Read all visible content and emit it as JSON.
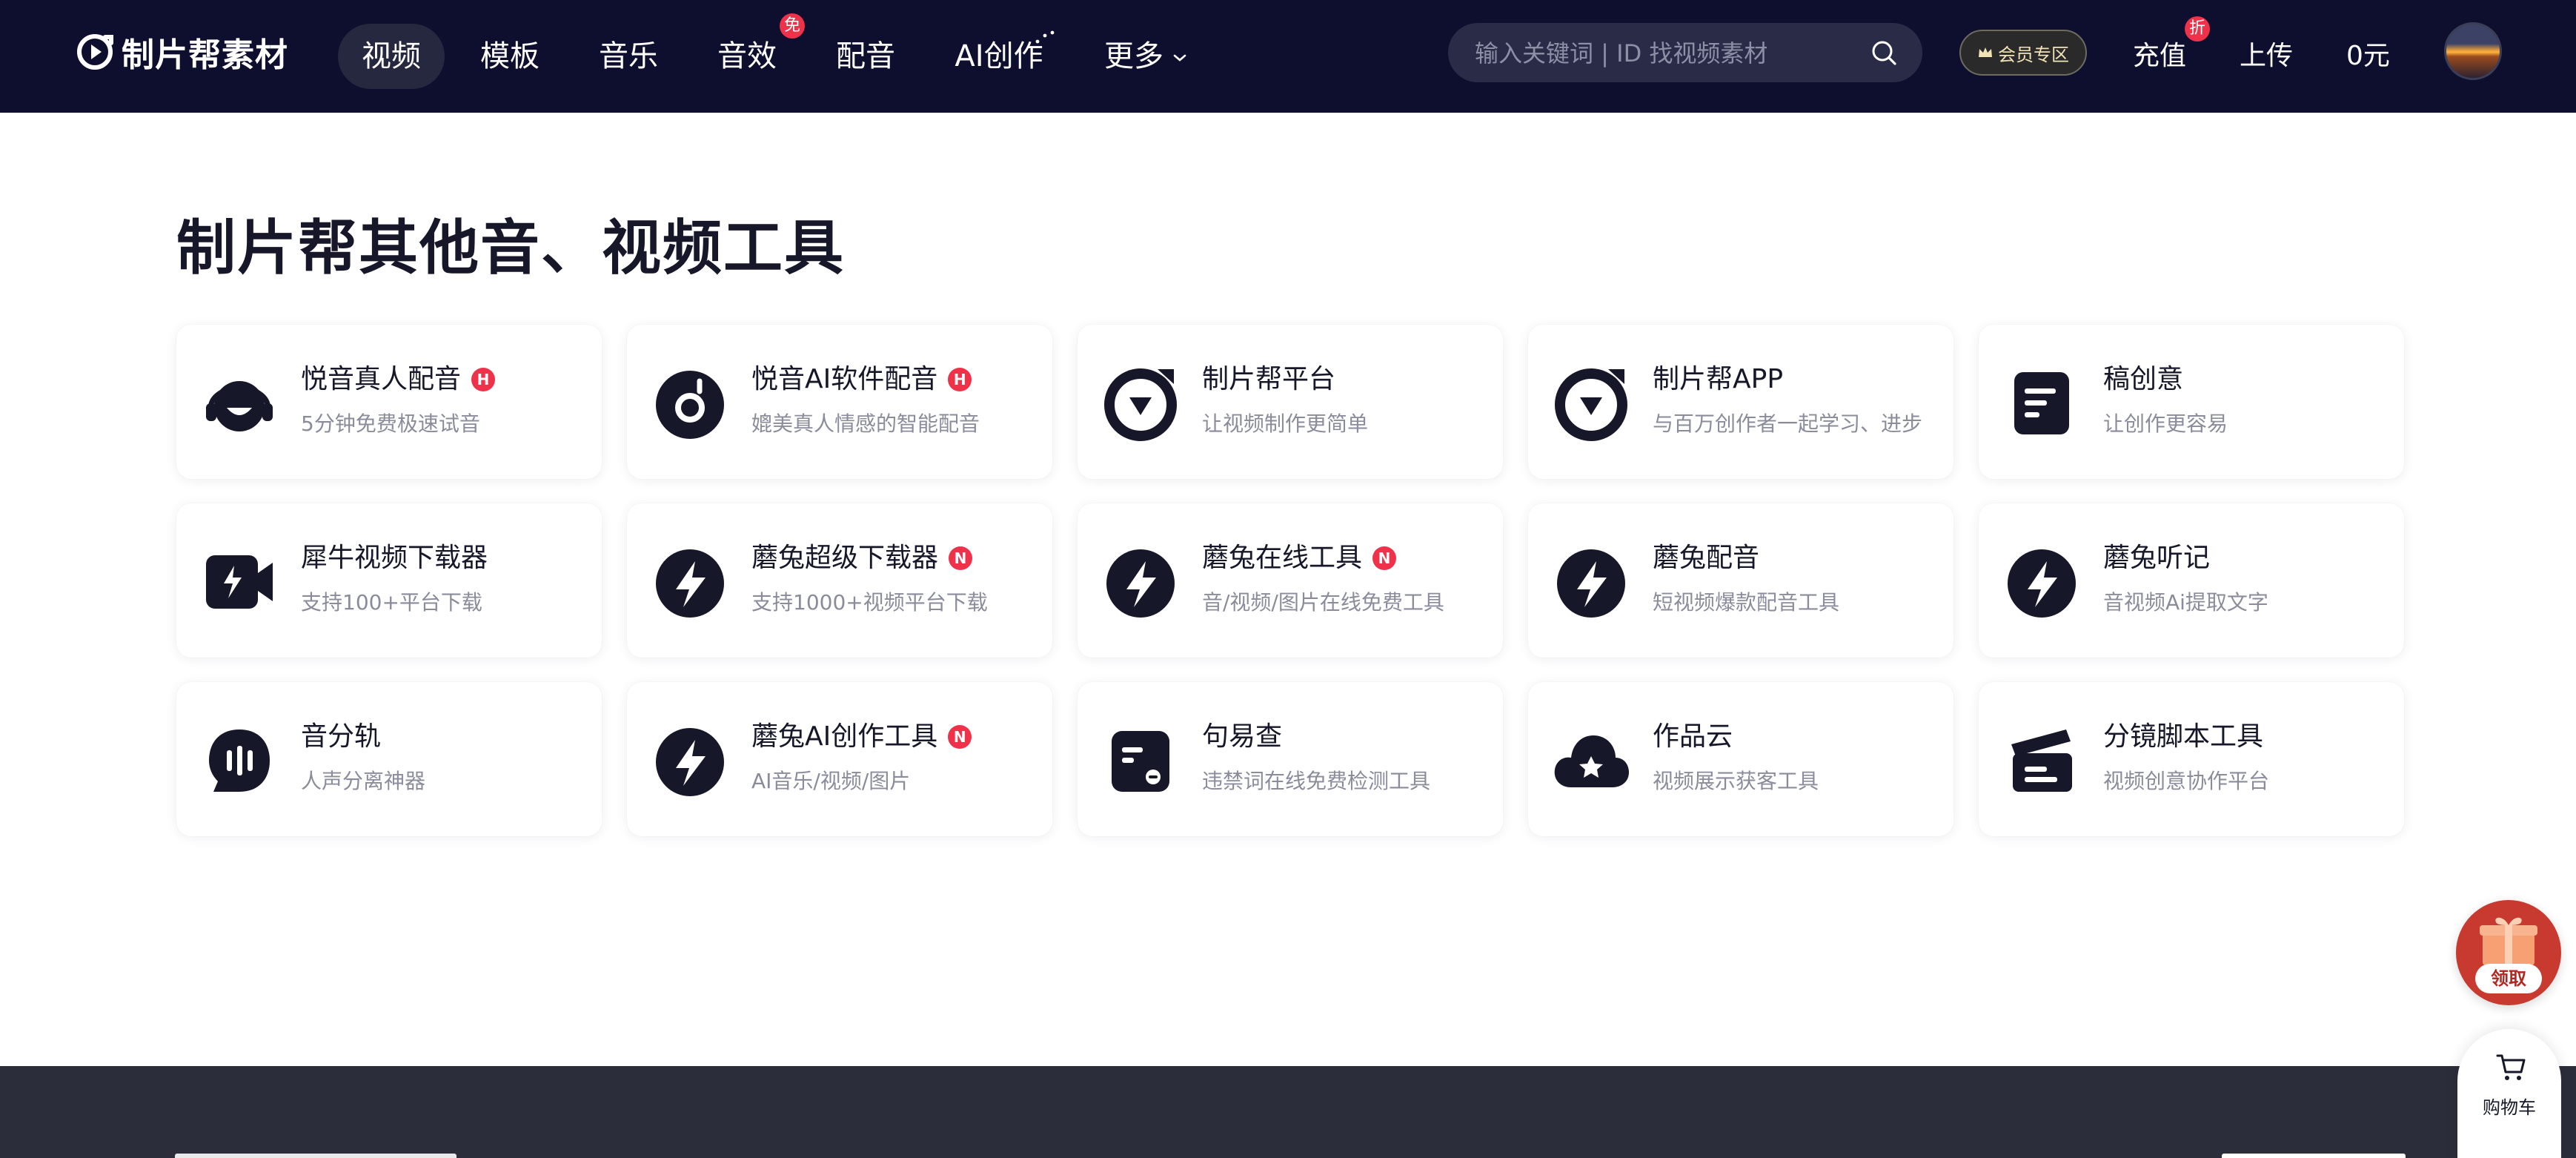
{
  "nav": {
    "logo_text": "制片帮素材",
    "items": [
      {
        "label": "视频",
        "active": true
      },
      {
        "label": "模板"
      },
      {
        "label": "音乐"
      },
      {
        "label": "音效",
        "badge": "免"
      },
      {
        "label": "配音"
      },
      {
        "label": "AI创作"
      },
      {
        "label": "更多"
      }
    ],
    "search_placeholder": "输入关键词 | ID 找视频素材",
    "vip_label": "会员专区",
    "recharge_label": "充值",
    "recharge_badge": "折",
    "upload_label": "上传",
    "balance_label": "0元"
  },
  "main": {
    "title": "制片帮其他音、视频工具",
    "tools": [
      {
        "title": "悦音真人配音",
        "badge": "H",
        "desc": "5分钟免费极速试音",
        "icon": "headset-icon"
      },
      {
        "title": "悦音AI软件配音",
        "badge": "H",
        "desc": "媲美真人情感的智能配音",
        "icon": "music-disc-icon"
      },
      {
        "title": "制片帮平台",
        "desc": "让视频制作更简单",
        "icon": "zhipianbang-logo-icon"
      },
      {
        "title": "制片帮APP",
        "desc": "与百万创作者一起学习、进步",
        "icon": "zhipianbang-logo-icon"
      },
      {
        "title": "稿创意",
        "desc": "让创作更容易",
        "icon": "document-icon"
      },
      {
        "title": "犀牛视频下载器",
        "desc": "支持100+平台下载",
        "icon": "video-camera-icon"
      },
      {
        "title": "蘑兔超级下载器",
        "badge": "N",
        "desc": "支持1000+视频平台下载",
        "icon": "lightning-icon"
      },
      {
        "title": "蘑兔在线工具",
        "badge": "N",
        "desc": "音/视频/图片在线免费工具",
        "icon": "lightning-icon"
      },
      {
        "title": "蘑兔配音",
        "desc": "短视频爆款配音工具",
        "icon": "lightning-icon"
      },
      {
        "title": "蘑兔听记",
        "desc": "音视频Ai提取文字",
        "icon": "lightning-icon"
      },
      {
        "title": "音分轨",
        "desc": "人声分离神器",
        "icon": "audio-wave-icon"
      },
      {
        "title": "蘑兔AI创作工具",
        "badge": "N",
        "desc": "AI音乐/视频/图片",
        "icon": "lightning-icon"
      },
      {
        "title": "句易查",
        "desc": "违禁词在线免费检测工具",
        "icon": "check-doc-icon"
      },
      {
        "title": "作品云",
        "desc": "视频展示获客工具",
        "icon": "cloud-icon"
      },
      {
        "title": "分镜脚本工具",
        "desc": "视频创意协作平台",
        "icon": "clapperboard-icon"
      }
    ]
  },
  "floats": {
    "gift_label": "领取",
    "cart_label": "购物车"
  }
}
